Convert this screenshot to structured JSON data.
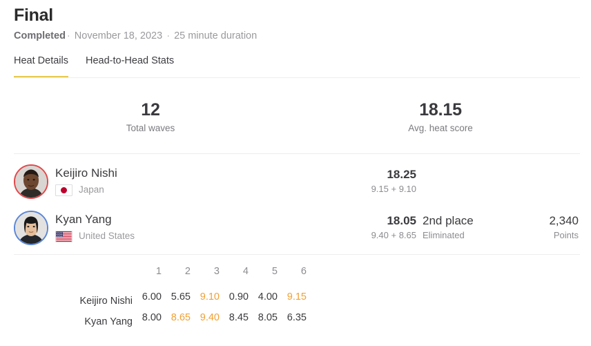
{
  "header": {
    "title": "Final",
    "status": "Completed",
    "separator": "·",
    "date": "November 18, 2023",
    "duration": "25 minute duration"
  },
  "tabs": [
    {
      "label": "Heat Details",
      "active": true
    },
    {
      "label": "Head-to-Head Stats",
      "active": false
    }
  ],
  "summary": {
    "stats": [
      {
        "value": "12",
        "label": "Total waves"
      },
      {
        "value": "18.15",
        "label": "Avg. heat score"
      }
    ]
  },
  "athletes": [
    {
      "name": "Keijiro Nishi",
      "country": "Japan",
      "flag": "japan-flag",
      "ring_color": "#e0484a",
      "heat_score": "18.25",
      "heat_score_breakdown": "9.15 + 9.10",
      "place": "",
      "place_status": "",
      "points": "",
      "points_label": ""
    },
    {
      "name": "Kyan Yang",
      "country": "United States",
      "flag": "united-states-flag",
      "ring_color": "#5b86d6",
      "heat_score": "18.05",
      "heat_score_breakdown": "9.40 + 8.65",
      "place": "2nd place",
      "place_status": "Eliminated",
      "points": "2,340",
      "points_label": "Points"
    }
  ],
  "wave_table": {
    "wave_numbers": [
      "1",
      "2",
      "3",
      "4",
      "5",
      "6"
    ],
    "rows": [
      {
        "name": "Keijiro Nishi",
        "scores": [
          "6.00",
          "5.65",
          "9.10",
          "0.90",
          "4.00",
          "9.15"
        ],
        "highlighted": [
          false,
          false,
          true,
          false,
          false,
          true
        ]
      },
      {
        "name": "Kyan Yang",
        "scores": [
          "8.00",
          "8.65",
          "9.40",
          "8.45",
          "8.05",
          "6.35"
        ],
        "highlighted": [
          false,
          true,
          true,
          false,
          false,
          false
        ]
      }
    ]
  },
  "colors": {
    "accent_tab_underline": "#e6c84f",
    "highlight_score": "#f0a033",
    "text_primary": "#3a3a3e",
    "text_secondary": "#8c8c91",
    "divider": "#ededee"
  }
}
